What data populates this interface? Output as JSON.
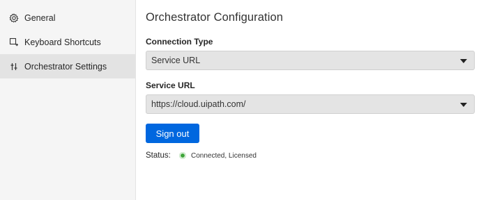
{
  "sidebar": {
    "items": [
      {
        "label": "General",
        "icon": "gear-icon",
        "active": false
      },
      {
        "label": "Keyboard Shortcuts",
        "icon": "keyboard-shortcut-icon",
        "active": false
      },
      {
        "label": "Orchestrator Settings",
        "icon": "orchestrator-settings-icon",
        "active": true
      }
    ]
  },
  "main": {
    "title": "Orchestrator Configuration",
    "connection_type": {
      "label": "Connection Type",
      "value": "Service URL"
    },
    "service_url": {
      "label": "Service URL",
      "value": "https://cloud.uipath.com/"
    },
    "sign_out_label": "Sign out",
    "status": {
      "label": "Status:",
      "value": "Connected, Licensed",
      "color": "#3fa63a"
    }
  },
  "colors": {
    "primary": "#0067df",
    "sidebar_bg": "#f5f5f5",
    "sidebar_active": "#e3e3e3"
  }
}
